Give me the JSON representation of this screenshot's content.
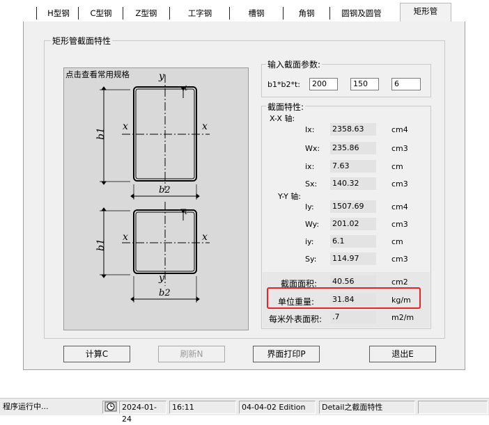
{
  "tabs": [
    {
      "label": "H型钢"
    },
    {
      "label": "C型钢"
    },
    {
      "label": "Z型钢"
    },
    {
      "label": "工字钢"
    },
    {
      "label": "槽钢"
    },
    {
      "label": "角钢"
    },
    {
      "label": "圆钢及圆管"
    },
    {
      "label": "矩形管"
    }
  ],
  "active_tab": "矩形管",
  "section_group_title": "矩形管截面特性",
  "diagram": {
    "click_label": "点击查看常用规格",
    "labels": {
      "x": "x",
      "y": "y",
      "t": "t",
      "b1": "b1",
      "b2": "b2"
    }
  },
  "input_params": {
    "title": "输入截面参数:",
    "label": "b1*b2*t:",
    "b1": "200",
    "b2": "150",
    "t": "6"
  },
  "properties": {
    "title": "截面特性:",
    "xx_axis_label": "X-X 轴:",
    "yy_axis_label": "Y-Y 轴:",
    "xx": [
      {
        "label": "Ix:",
        "value": "2358.63",
        "unit": "cm4"
      },
      {
        "label": "Wx:",
        "value": "235.86",
        "unit": "cm3"
      },
      {
        "label": "ix:",
        "value": "7.63",
        "unit": "cm"
      },
      {
        "label": "Sx:",
        "value": "140.32",
        "unit": "cm3"
      }
    ],
    "yy": [
      {
        "label": "Iy:",
        "value": "1507.69",
        "unit": "cm4"
      },
      {
        "label": "Wy:",
        "value": "201.02",
        "unit": "cm3"
      },
      {
        "label": "iy:",
        "value": "6.1",
        "unit": "cm"
      },
      {
        "label": "Sy:",
        "value": "114.97",
        "unit": "cm3"
      }
    ],
    "area": {
      "label": "截面面积:",
      "value": "40.56",
      "unit": "cm2"
    },
    "unit_weight": {
      "label": "单位重量:",
      "value": "31.84",
      "unit": "kg/m"
    },
    "surface_area": {
      "label": "每米外表面积:",
      "value": ".7",
      "unit": "m2/m"
    }
  },
  "buttons": {
    "calculate": "计算C",
    "refresh": "刷新N",
    "print": "界面打印P",
    "exit": "退出E"
  },
  "status": {
    "running": "程序运行中...",
    "date": "2024-01-24",
    "time": "16:11",
    "edition": "04-04-02 Edition",
    "detail": "Detail之截面特性"
  },
  "colors": {
    "highlight": "#e5252a",
    "window_bg": "#f0f0f0",
    "diagram_bg": "#d9d9d9"
  }
}
